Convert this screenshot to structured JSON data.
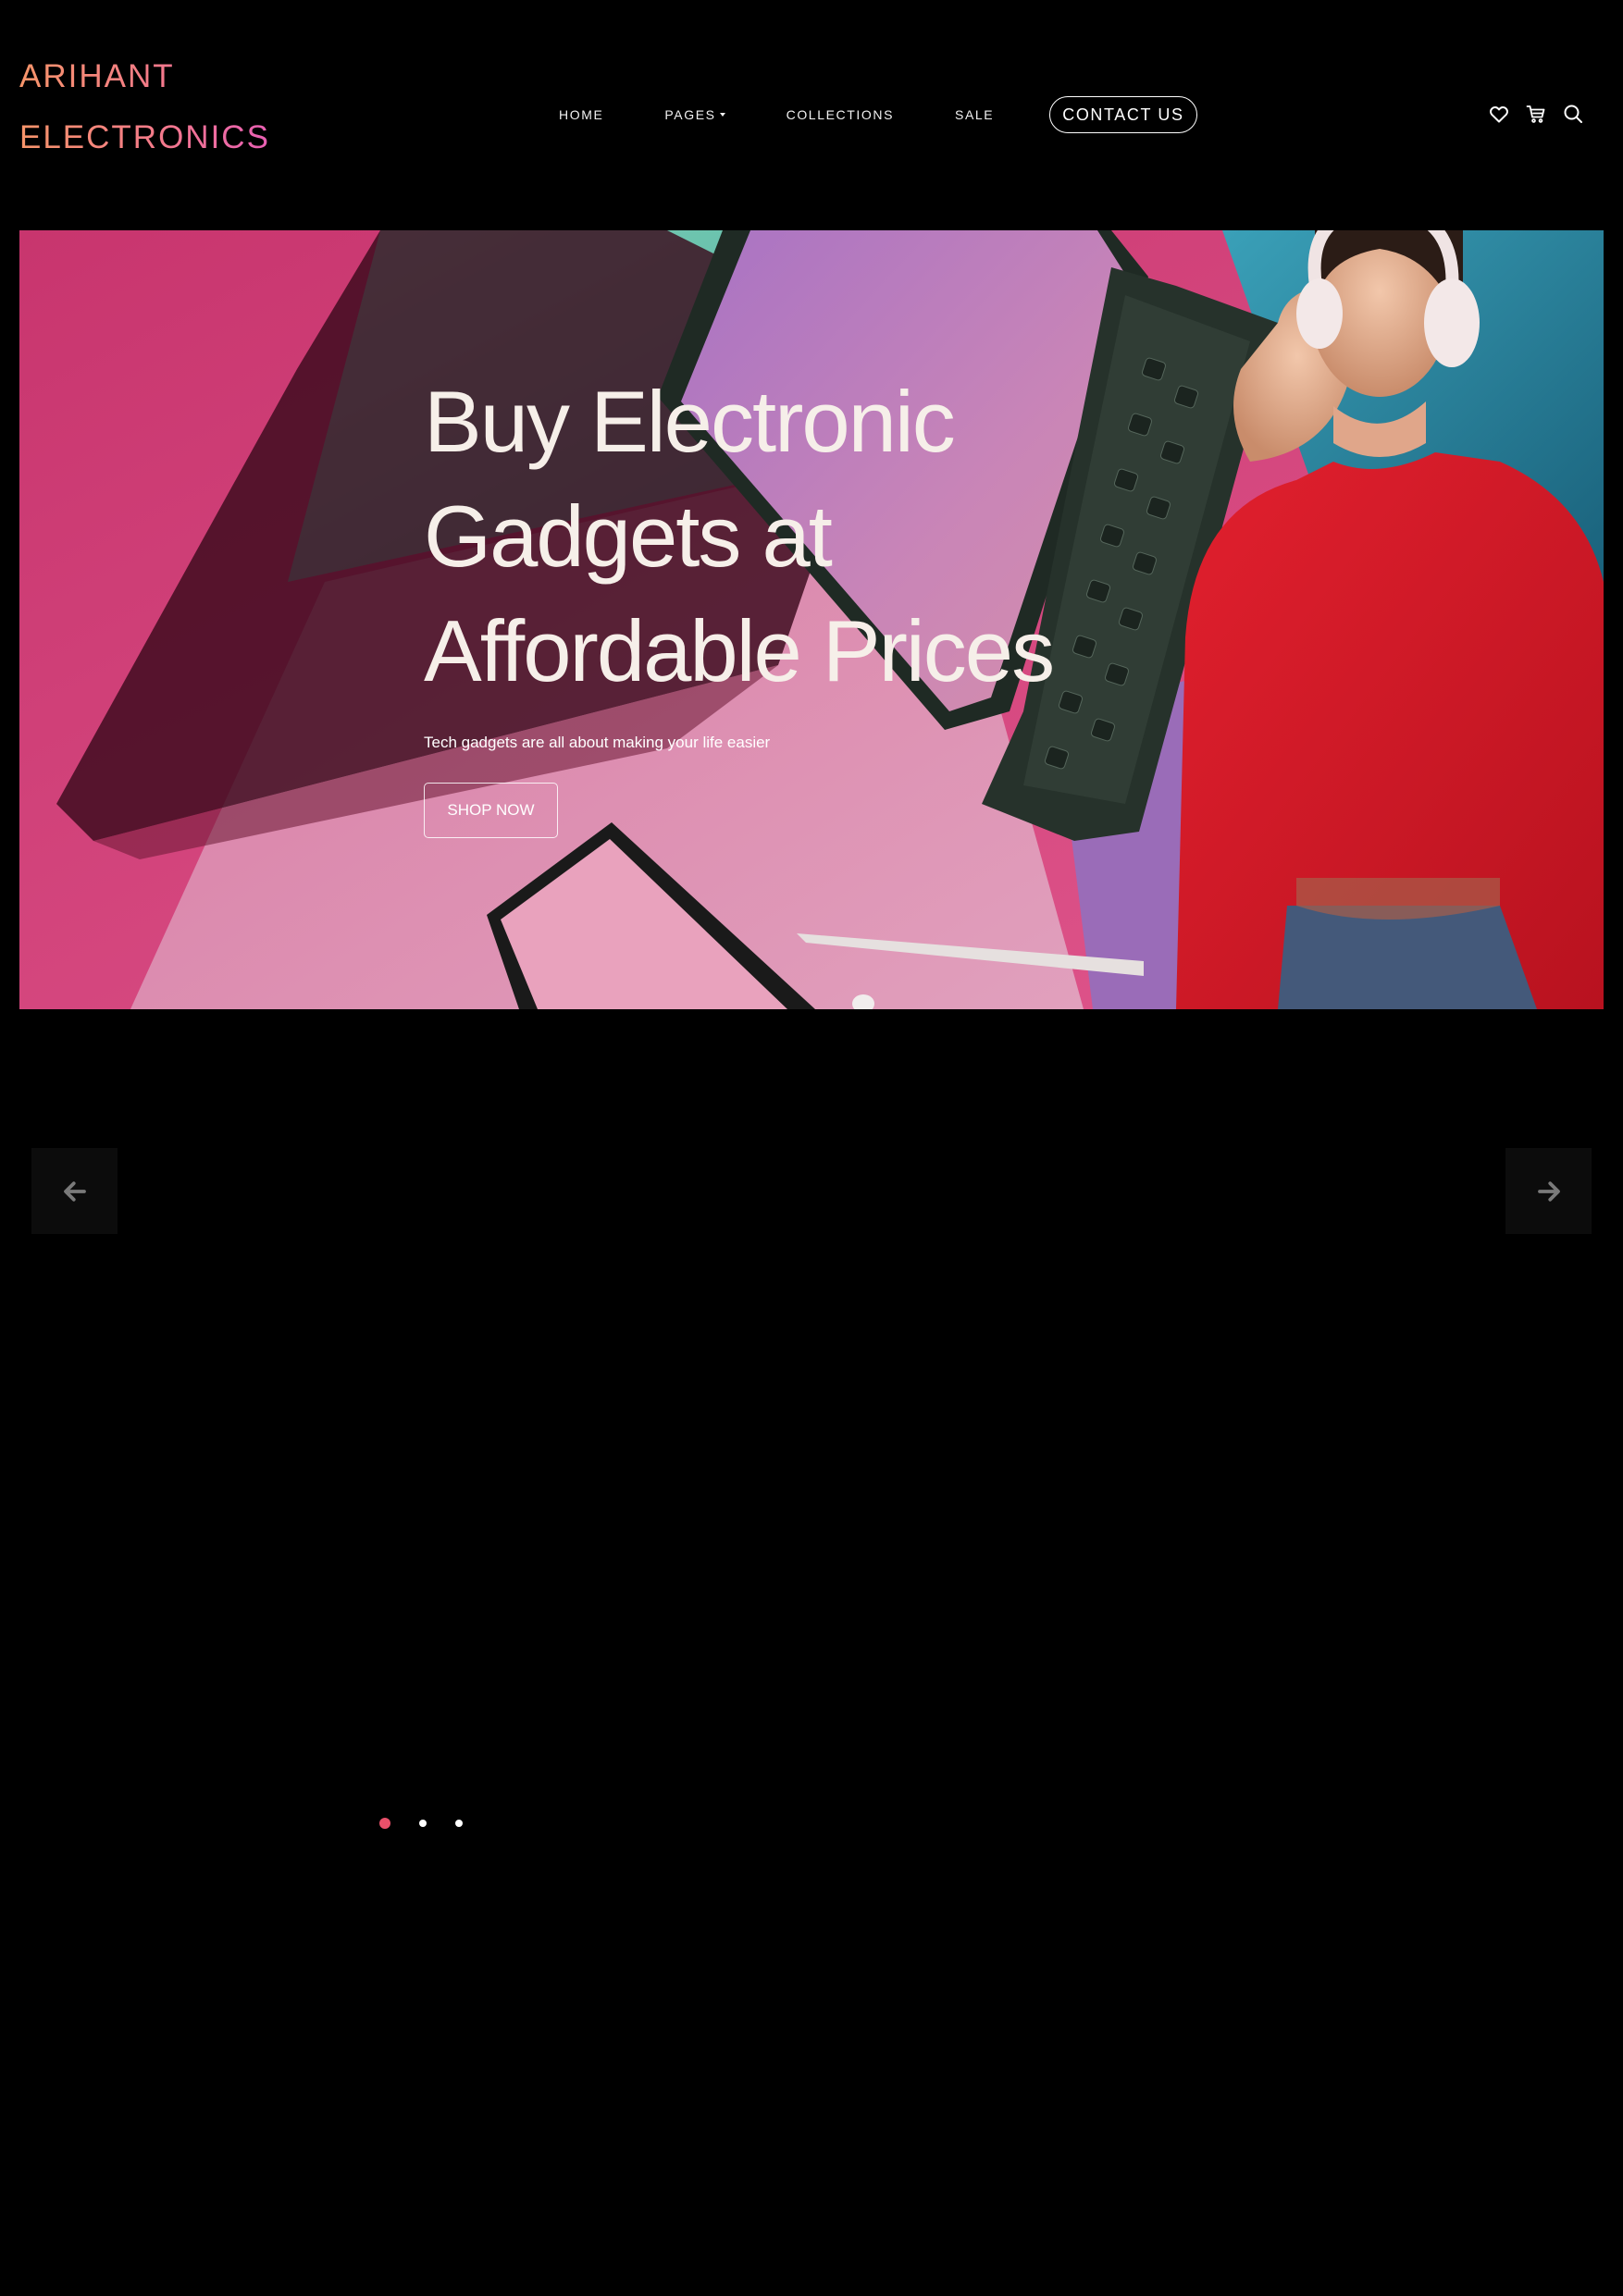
{
  "brand": {
    "line1": "ARIHANT",
    "line2": "ELECTRONICS",
    "gradient": [
      "#f7956a",
      "#e85fb4"
    ]
  },
  "nav": {
    "items": [
      {
        "label": "HOME"
      },
      {
        "label": "PAGES",
        "has_dropdown": true
      },
      {
        "label": "COLLECTIONS"
      },
      {
        "label": "SALE"
      }
    ],
    "contact_label": "CONTACT US"
  },
  "header_icons": [
    "heart-icon",
    "cart-icon",
    "search-icon"
  ],
  "hero": {
    "title_lines": [
      "Buy Electronic",
      "Gadgets at",
      "Affordable Prices"
    ],
    "subtitle": "Tech gadgets are all about making your life easier",
    "cta_label": "SHOP NOW"
  },
  "slider": {
    "prev_icon": "arrow-left-icon",
    "next_icon": "arrow-right-icon",
    "slide_count": 3,
    "active_index": 0,
    "active_color": "#e8506a"
  }
}
